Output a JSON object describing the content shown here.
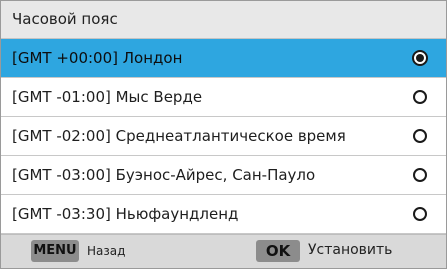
{
  "title": "Часовой пояс",
  "timezones": [
    {
      "label": "[GMT +00:00] Лондон",
      "selected": true
    },
    {
      "label": "[GMT -01:00] Мыс Верде",
      "selected": false
    },
    {
      "label": "[GMT -02:00] Среднеатлантическое время",
      "selected": false
    },
    {
      "label": "[GMT -03:00] Буэнос-Айрес, Сан-Пауло",
      "selected": false
    },
    {
      "label": "[GMT -03:30] Ньюфаундленд",
      "selected": false
    }
  ],
  "footer": {
    "menu_key": "MENU",
    "back_label": "Назад",
    "ok_key": "OK",
    "set_label": "Установить"
  },
  "colors": {
    "highlight": "#2ea6e0",
    "title_bg": "#e8e8e8",
    "footer_bg": "#d9d9d9",
    "key_bg": "#8c8c8c"
  }
}
